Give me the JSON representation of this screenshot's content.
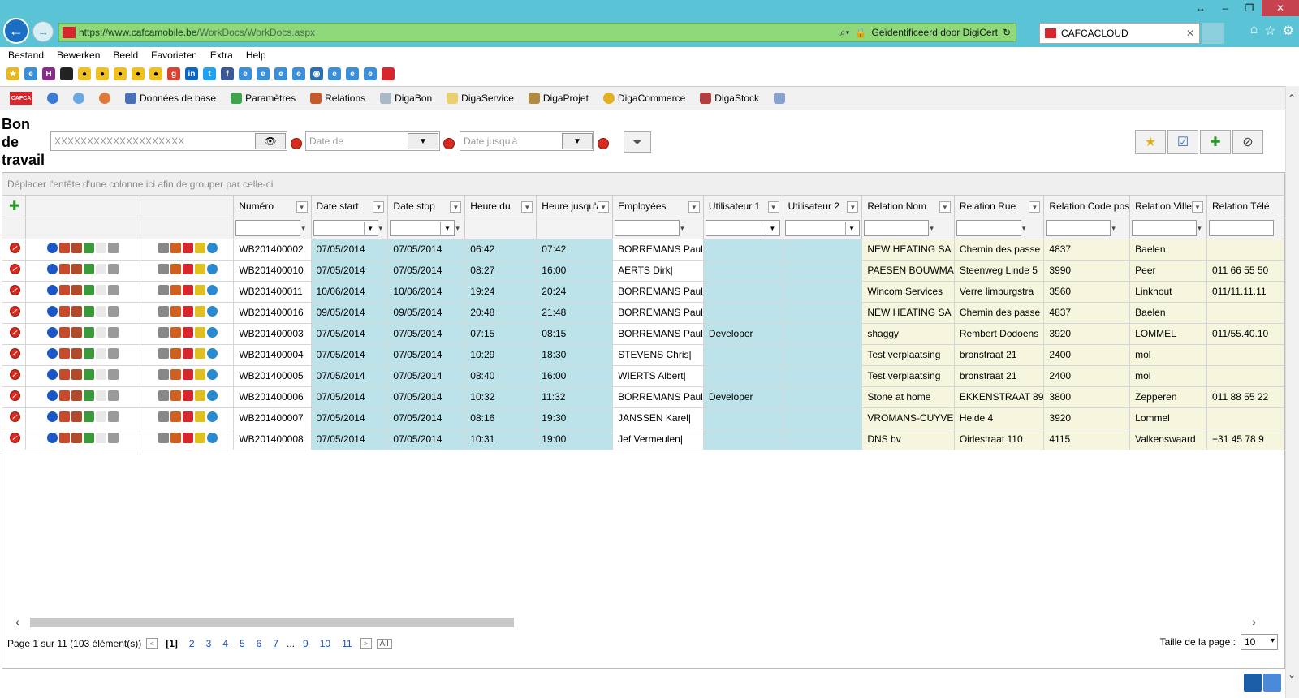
{
  "browser": {
    "url_host": "https://www.cafcamobile.be",
    "url_path": "/WorkDocs/WorkDocs.aspx",
    "identity": "Geïdentificeerd door DigiCert",
    "tab_title": "CAFCACLOUD",
    "menu": [
      "Bestand",
      "Bewerken",
      "Beeld",
      "Favorieten",
      "Extra",
      "Help"
    ]
  },
  "toolbar": {
    "logo_text": "CAFCA",
    "items": [
      "Données de base",
      "Paramètres",
      "Relations",
      "DigaBon",
      "DigaService",
      "DigaProjet",
      "DigaCommerce",
      "DigaStock"
    ]
  },
  "page": {
    "title": "Bon de travail",
    "search_value": "XXXXXXXXXXXXXXXXXXXX",
    "date_from_placeholder": "Date de",
    "date_to_placeholder": "Date jusqu'à"
  },
  "grid": {
    "group_hint": "Déplacer l'entête d'une colonne ici afin de grouper par celle-ci",
    "columns": [
      "Numéro",
      "Date start",
      "Date stop",
      "Heure du",
      "Heure jusqu'à",
      "Employées",
      "Utilisateur 1",
      "Utilisateur 2",
      "Relation Nom",
      "Relation Rue",
      "Relation Code pos",
      "Relation Ville",
      "Relation Télé"
    ],
    "rows": [
      [
        "WB201400002",
        "07/05/2014",
        "07/05/2014",
        "06:42",
        "07:42",
        "BORREMANS Paul",
        "",
        "",
        "NEW HEATING SA",
        "Chemin des passe",
        "4837",
        "Baelen",
        ""
      ],
      [
        "WB201400010",
        "07/05/2014",
        "07/05/2014",
        "08:27",
        "16:00",
        "AERTS Dirk|",
        "",
        "",
        "PAESEN BOUWMA",
        "Steenweg Linde 5",
        "3990",
        "Peer",
        "011 66 55 50"
      ],
      [
        "WB201400011",
        "10/06/2014",
        "10/06/2014",
        "19:24",
        "20:24",
        "BORREMANS Paul",
        "",
        "",
        "Wincom Services",
        "Verre limburgstra",
        "3560",
        "Linkhout",
        "011/11.11.11"
      ],
      [
        "WB201400016",
        "09/05/2014",
        "09/05/2014",
        "20:48",
        "21:48",
        "BORREMANS Paul",
        "",
        "",
        "NEW HEATING SA",
        "Chemin des passe",
        "4837",
        "Baelen",
        ""
      ],
      [
        "WB201400003",
        "07/05/2014",
        "07/05/2014",
        "07:15",
        "08:15",
        "BORREMANS Paul",
        "Developer",
        "",
        "shaggy",
        "Rembert Dodoens",
        "3920",
        "LOMMEL",
        "011/55.40.10"
      ],
      [
        "WB201400004",
        "07/05/2014",
        "07/05/2014",
        "10:29",
        "18:30",
        "STEVENS Chris|",
        "",
        "",
        "Test verplaatsing",
        "bronstraat 21",
        "2400",
        "mol",
        ""
      ],
      [
        "WB201400005",
        "07/05/2014",
        "07/05/2014",
        "08:40",
        "16:00",
        "WIERTS Albert|",
        "",
        "",
        "Test verplaatsing",
        "bronstraat 21",
        "2400",
        "mol",
        ""
      ],
      [
        "WB201400006",
        "07/05/2014",
        "07/05/2014",
        "10:32",
        "11:32",
        "BORREMANS Paul",
        "Developer",
        "",
        "Stone at home",
        "EKKENSTRAAT 89",
        "3800",
        "Zepperen",
        "011 88 55 22"
      ],
      [
        "WB201400007",
        "07/05/2014",
        "07/05/2014",
        "08:16",
        "19:30",
        "JANSSEN Karel|",
        "",
        "",
        "VROMANS-CUYVE",
        "Heide 4",
        "3920",
        "Lommel",
        ""
      ],
      [
        "WB201400008",
        "07/05/2014",
        "07/05/2014",
        "10:31",
        "19:00",
        "Jef Vermeulen|",
        "",
        "",
        "DNS bv",
        "Oirlestraat 110",
        "4115",
        "Valkenswaard",
        "+31 45 78 9"
      ]
    ]
  },
  "pager": {
    "summary": "Page 1 sur 11 (103 élément(s))",
    "current": "[1]",
    "pages": [
      "2",
      "3",
      "4",
      "5",
      "6",
      "7",
      "...",
      "9",
      "10",
      "11"
    ],
    "all_label": "All",
    "page_size_label": "Taille de la page :",
    "page_size": "10"
  },
  "colors": {
    "chrome": "#5bc3d6",
    "address": "#8fd97a",
    "blue_cell": "#bde3ea",
    "cream_cell": "#f6f5dd",
    "delete": "#d72a1e"
  }
}
